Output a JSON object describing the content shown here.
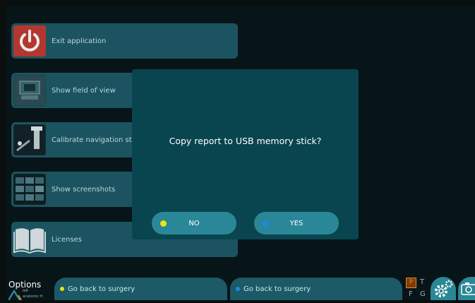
{
  "menu": {
    "items": [
      {
        "label": "Exit application",
        "icon": "power-icon"
      },
      {
        "label": "Show field of view",
        "icon": "field-of-view-thumbnail"
      },
      {
        "label": "Calibrate navigation sta",
        "icon": "calibrate-navigation-thumbnail"
      },
      {
        "label": "Show screenshots",
        "icon": "screenshots-thumbnail"
      },
      {
        "label": "Licenses",
        "icon": "book-icon"
      }
    ]
  },
  "dialog": {
    "message": "Copy report to USB memory stick?",
    "no_label": "NO",
    "yes_label": "YES",
    "no_dot_color": "#f1e10c",
    "yes_dot_color": "#1b87e6"
  },
  "bottom": {
    "options_title": "Options",
    "options_sub": "left",
    "logo_text": "anatomic ft",
    "back_left": "Go back to surgery",
    "back_right": "Go back to surgery",
    "indicator_p": "P",
    "indicator_t": "T",
    "indicator_f": "F",
    "indicator_g": "G"
  },
  "colors": {
    "accent": "#2a8797",
    "menu_button": "#1d5a67",
    "dialog_bg": "#09454f",
    "power_red": "#c33a32",
    "indicator_orange": "#e48a1e"
  }
}
